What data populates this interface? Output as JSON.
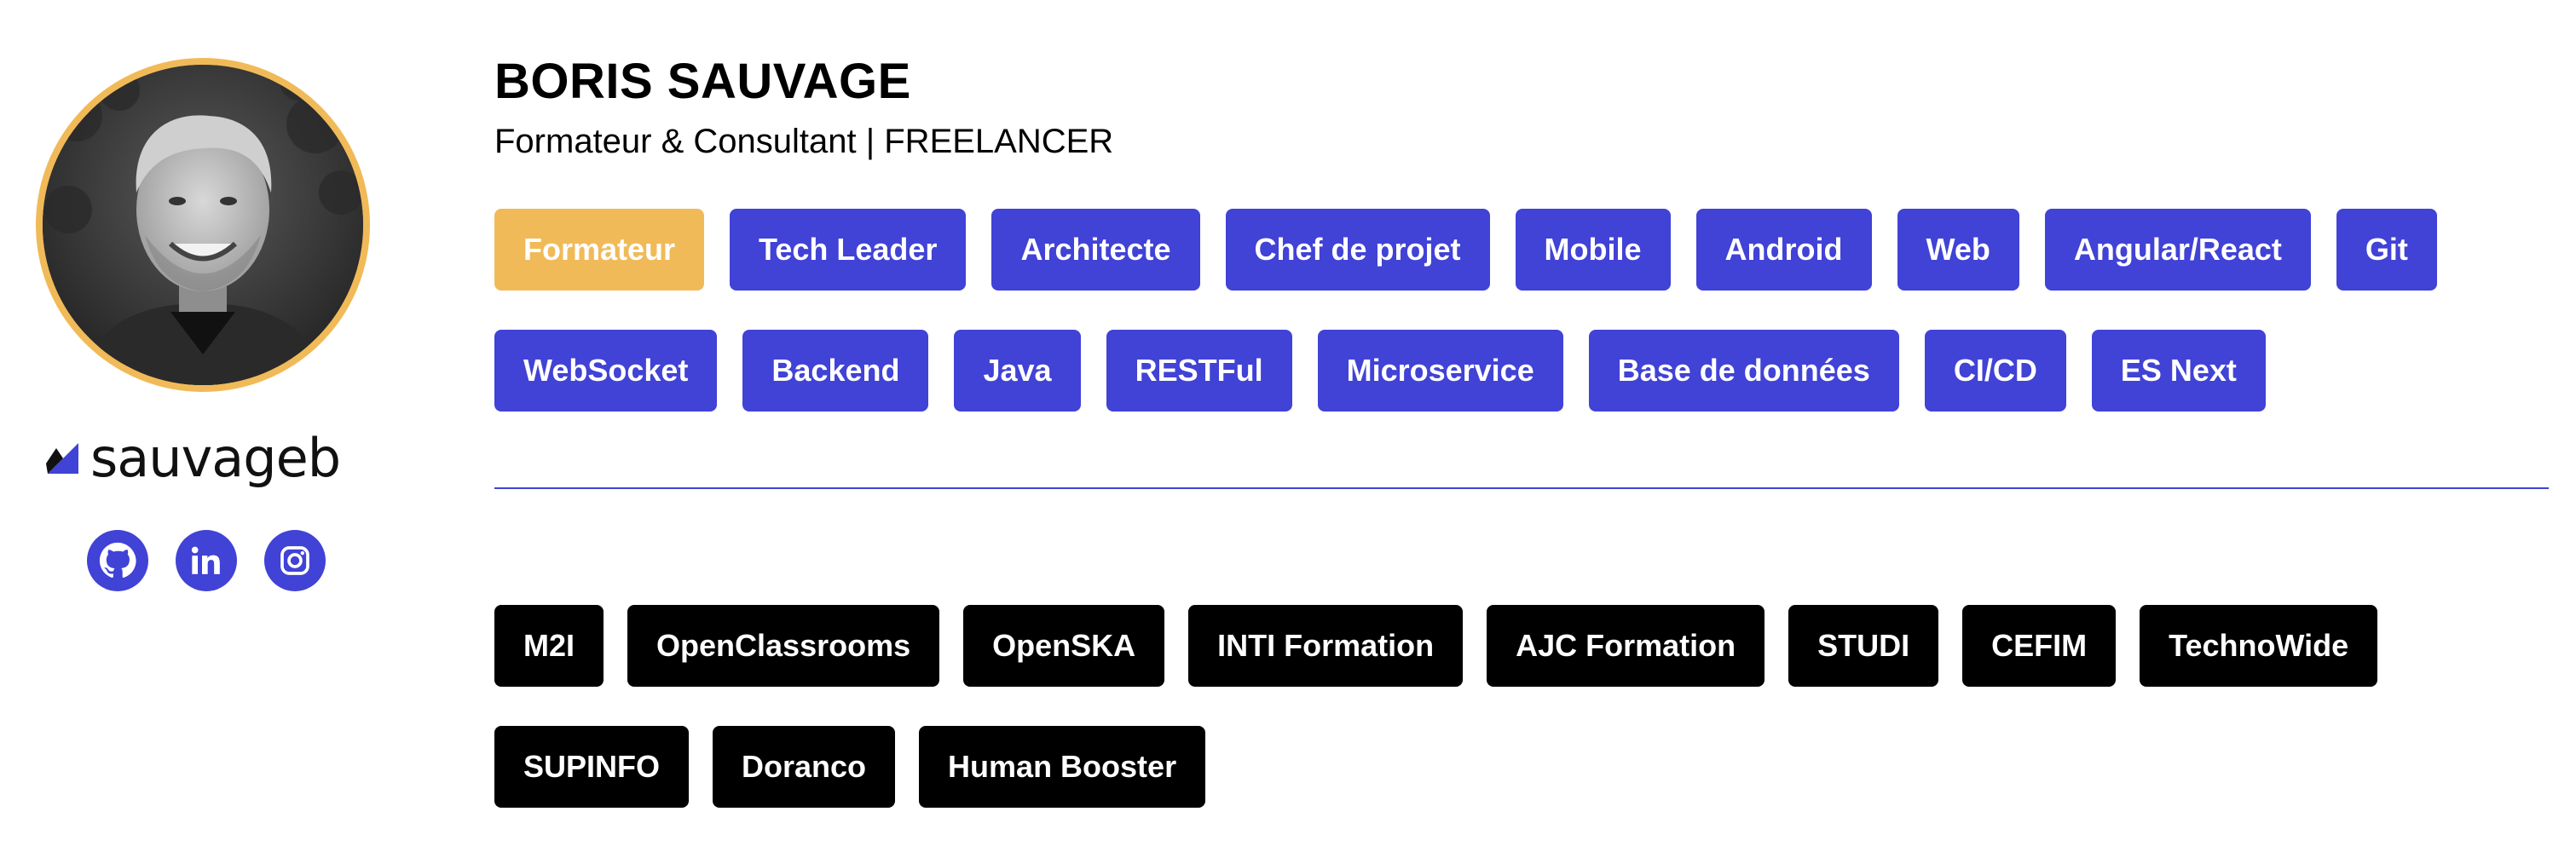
{
  "profile": {
    "name": "BORIS SAUVAGE",
    "subtitle": "Formateur & Consultant | FREELANCER"
  },
  "brand": {
    "text": "sauvageb",
    "color": "#4142d6"
  },
  "social": [
    {
      "icon": "github-icon"
    },
    {
      "icon": "linkedin-icon"
    },
    {
      "icon": "instagram-icon"
    }
  ],
  "skills": [
    {
      "label": "Formateur",
      "active": true
    },
    {
      "label": "Tech Leader"
    },
    {
      "label": "Architecte"
    },
    {
      "label": "Chef de projet"
    },
    {
      "label": "Mobile"
    },
    {
      "label": "Android"
    },
    {
      "label": "Web"
    },
    {
      "label": "Angular/React"
    },
    {
      "label": "Git"
    },
    {
      "label": "WebSocket"
    },
    {
      "label": "Backend"
    },
    {
      "label": "Java"
    },
    {
      "label": "RESTFul"
    },
    {
      "label": "Microservice"
    },
    {
      "label": "Base de données"
    },
    {
      "label": "CI/CD"
    },
    {
      "label": "ES Next"
    }
  ],
  "organizations": [
    {
      "label": "M2I"
    },
    {
      "label": "OpenClassrooms"
    },
    {
      "label": "OpenSKA"
    },
    {
      "label": "INTI Formation"
    },
    {
      "label": "AJC Formation"
    },
    {
      "label": "STUDI"
    },
    {
      "label": "CEFIM"
    },
    {
      "label": "TechnoWide"
    },
    {
      "label": "SUPINFO"
    },
    {
      "label": "Doranco"
    },
    {
      "label": "Human Booster"
    }
  ],
  "colors": {
    "accent": "#4142d6",
    "active": "#f1ba58",
    "org_tag": "#000000",
    "avatar_ring": "#f1ba58"
  }
}
